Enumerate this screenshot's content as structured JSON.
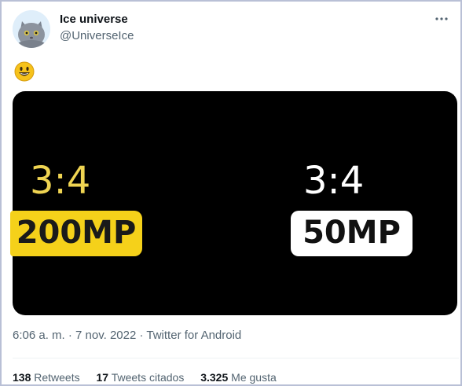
{
  "tweet": {
    "author_name": "Ice universe",
    "author_handle": "@UniverseIce",
    "emoji": "smiling-face-emoji",
    "media": {
      "left_ratio": "3:4",
      "left_badge": "200MP",
      "right_ratio": "3:4",
      "right_badge": "50MP",
      "left_color": "#f5d11a",
      "right_color": "#ffffff"
    },
    "timestamp": "6:06 a. m. · 7 nov. 2022 · ",
    "source": "Twitter for Android",
    "stats": [
      {
        "count": "138",
        "label": "Retweets"
      },
      {
        "count": "17",
        "label": "Tweets citados"
      },
      {
        "count": "3.325",
        "label": "Me gusta"
      }
    ]
  },
  "icons": {
    "more": "more-horizontal-icon",
    "avatar": "cat-avatar"
  }
}
